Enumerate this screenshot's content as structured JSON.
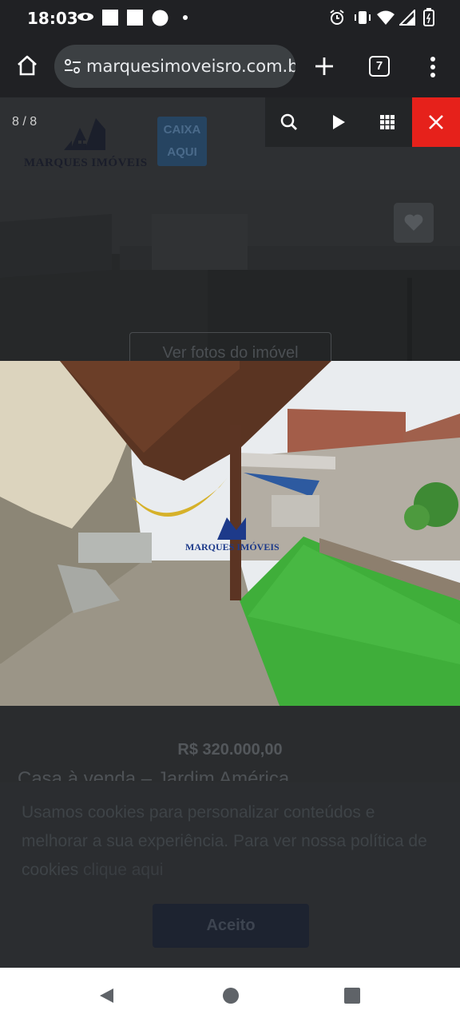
{
  "status_bar": {
    "time": "18:03"
  },
  "browser": {
    "url": "marquesimoveisro.com.br",
    "tab_count": "7"
  },
  "lightbox": {
    "counter": "8 / 8"
  },
  "header": {
    "logo_text": "MARQUES IMÓVEIS",
    "caixa_line1": "CAIXA",
    "caixa_line2": "AQUI"
  },
  "gallery": {
    "button_label": "Ver fotos do imóvel",
    "watermark": "MARQUES IMÓVEIS"
  },
  "listing": {
    "price": "R$ 320.000,00",
    "title": "Casa à venda – Jardim América"
  },
  "cookie_banner": {
    "text": "Usamos cookies para personalizar conteúdos e melhorar a sua experiência. Para ver nossa política de cookies",
    "link": "clique aqui",
    "accept_label": "Aceito"
  },
  "icons": [
    "home-icon",
    "site-settings-icon",
    "plus-icon",
    "tab-switcher-icon",
    "more-vert-icon",
    "search-icon",
    "play-icon",
    "grid-icon",
    "close-icon",
    "heart-icon",
    "back-icon",
    "home-circle-icon",
    "recents-icon"
  ],
  "colors": {
    "close_button": "#e6211b",
    "grass": "#3fae3a"
  }
}
